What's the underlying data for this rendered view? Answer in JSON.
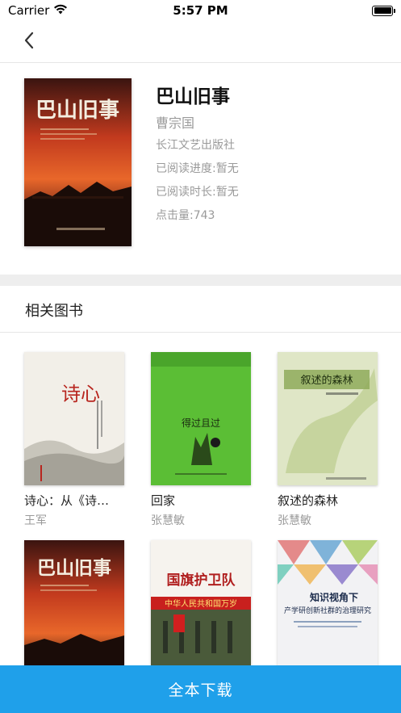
{
  "status_bar": {
    "carrier": "Carrier",
    "time": "5:57 PM"
  },
  "nav": {
    "back_icon": "chevron-left-icon"
  },
  "book": {
    "title": "巴山旧事",
    "author": "曹宗国",
    "publisher": "长江文艺出版社",
    "progress": "已阅读进度:暂无",
    "duration": "已阅读时长:暂无",
    "clicks": "点击量:743",
    "cover_text": "巴山旧事"
  },
  "related": {
    "heading": "相关图书",
    "items": [
      {
        "title": "诗心：从《诗…",
        "author": "王军",
        "cover_text": "诗心"
      },
      {
        "title": "回家",
        "author": "张慧敏",
        "cover_text": "得过且过"
      },
      {
        "title": "叙述的森林",
        "author": "张慧敏",
        "cover_text": "叙述的森林"
      },
      {
        "title": "",
        "author": "",
        "cover_text": "巴山旧事"
      },
      {
        "title": "",
        "author": "",
        "cover_text": "国旗护卫队",
        "cover_sub": "中华人民共和国万岁"
      },
      {
        "title": "",
        "author": "",
        "cover_text": "知识视角下",
        "cover_sub": "产学研创新社群的治理研究"
      }
    ]
  },
  "footer": {
    "download_label": "全本下载"
  },
  "colors": {
    "accent": "#1fa0ea",
    "muted": "#9a9a9a"
  }
}
